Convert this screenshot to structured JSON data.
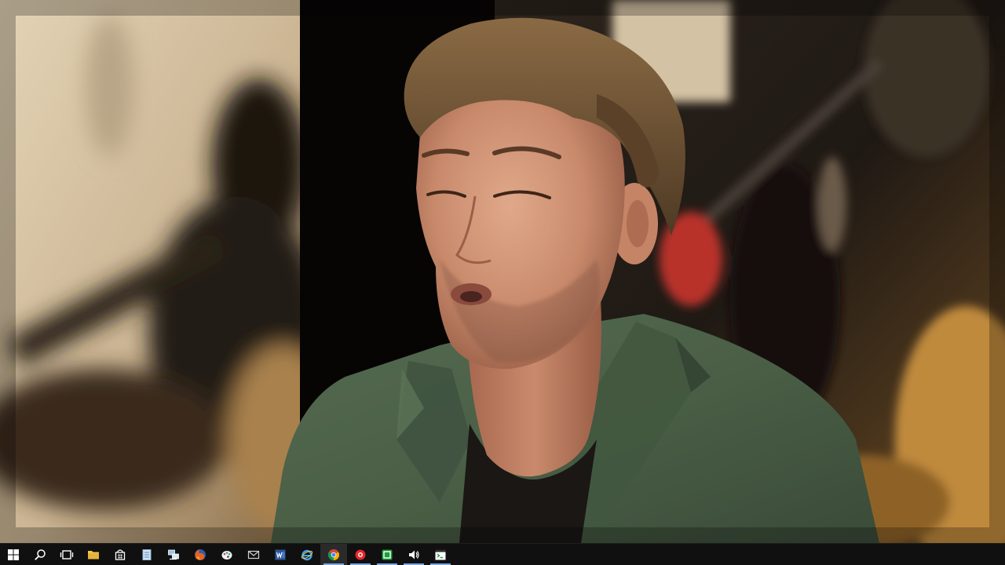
{
  "screen": {
    "type": "video-still-with-desktop-taskbar"
  },
  "video": {
    "scene": "studio-interview",
    "subject": "man-in-green-blazer"
  },
  "taskbar": {
    "items": [
      {
        "id": "start",
        "icon": "windows-logo-icon",
        "state": "idle"
      },
      {
        "id": "search",
        "icon": "search-icon",
        "state": "idle"
      },
      {
        "id": "task-view",
        "icon": "task-view-icon",
        "state": "idle"
      },
      {
        "id": "file-explorer",
        "icon": "folder-icon",
        "state": "idle"
      },
      {
        "id": "store",
        "icon": "store-icon",
        "state": "idle"
      },
      {
        "id": "app-document",
        "icon": "document-icon",
        "state": "idle"
      },
      {
        "id": "app-network",
        "icon": "network-icon",
        "state": "idle"
      },
      {
        "id": "firefox",
        "icon": "firefox-icon",
        "state": "idle"
      },
      {
        "id": "app-paint",
        "icon": "paint-icon",
        "state": "idle"
      },
      {
        "id": "app-mail",
        "icon": "mail-icon",
        "state": "idle"
      },
      {
        "id": "word",
        "icon": "word-icon",
        "state": "idle"
      },
      {
        "id": "internet-explorer",
        "icon": "ie-icon",
        "state": "idle"
      },
      {
        "id": "chrome",
        "icon": "chrome-icon",
        "state": "active"
      },
      {
        "id": "app-red",
        "icon": "red-circle-app-icon",
        "state": "running"
      },
      {
        "id": "app-green",
        "icon": "green-app-icon",
        "state": "running"
      },
      {
        "id": "audio",
        "icon": "speaker-icon",
        "state": "running"
      },
      {
        "id": "app-cmd",
        "icon": "terminal-icon",
        "state": "running"
      }
    ]
  },
  "colors": {
    "taskbar_bg": "#101010",
    "active_bg": "#2a2a2a",
    "running_indicator": "#7aa8e0",
    "blazer_green": "#4c6248",
    "backdrop_warm": "#d8c7a8"
  }
}
